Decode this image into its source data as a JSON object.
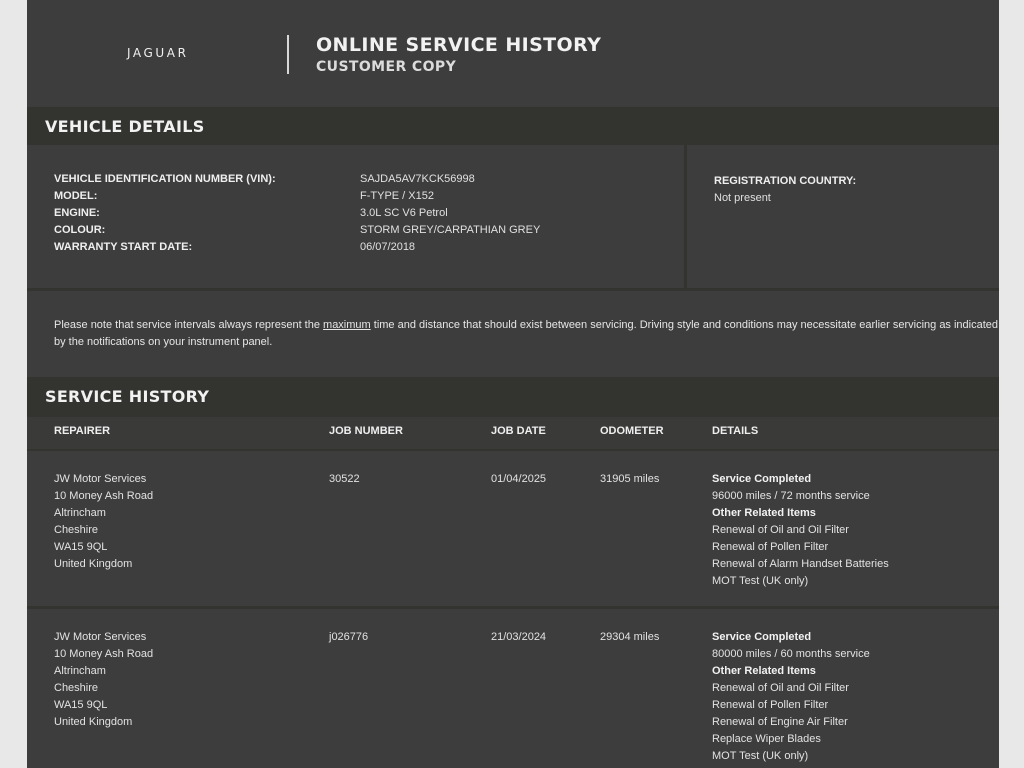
{
  "header": {
    "brand": "JAGUAR",
    "title": "ONLINE SERVICE HISTORY",
    "subtitle": "CUSTOMER COPY"
  },
  "vehicle": {
    "heading": "VEHICLE DETAILS",
    "fields": [
      {
        "label": "VEHICLE IDENTIFICATION NUMBER (VIN):",
        "value": "SAJDA5AV7KCK56998"
      },
      {
        "label": "MODEL:",
        "value": "F-TYPE / X152"
      },
      {
        "label": "ENGINE:",
        "value": "3.0L SC V6 Petrol"
      },
      {
        "label": "COLOUR:",
        "value": "STORM GREY/CARPATHIAN GREY"
      },
      {
        "label": "WARRANTY START DATE:",
        "value": "06/07/2018"
      }
    ],
    "registration_label": "REGISTRATION COUNTRY:",
    "registration_value": "Not present"
  },
  "notice": {
    "before": "Please note that service intervals always represent the ",
    "emphasis": "maximum",
    "after": " time and distance that should exist between servicing. Driving style and conditions may necessitate earlier servicing as indicated by the notifications on your instrument panel."
  },
  "service_history": {
    "heading": "SERVICE HISTORY",
    "columns": [
      "REPAIRER",
      "JOB NUMBER",
      "JOB DATE",
      "ODOMETER",
      "DETAILS"
    ],
    "jobs": [
      {
        "repairer": [
          "JW Motor Services",
          "10 Money Ash Road",
          "Altrincham",
          "Cheshire",
          "WA15 9QL",
          "United Kingdom"
        ],
        "job_number": "30522",
        "job_date": "01/04/2025",
        "odometer": "31905 miles",
        "service_label": "Service Completed",
        "service": "96000 miles / 72 months service",
        "other_label": "Other Related Items",
        "items": [
          "Renewal of Oil and Oil Filter",
          "Renewal of Pollen Filter",
          "Renewal of Alarm Handset Batteries",
          "MOT Test (UK only)"
        ]
      },
      {
        "repairer": [
          "JW Motor Services",
          "10 Money Ash Road",
          "Altrincham",
          "Cheshire",
          "WA15 9QL",
          "United Kingdom"
        ],
        "job_number": "j026776",
        "job_date": "21/03/2024",
        "odometer": "29304 miles",
        "service_label": "Service Completed",
        "service": "80000 miles / 60 months service",
        "other_label": "Other Related Items",
        "items": [
          "Renewal of Oil and Oil Filter",
          "Renewal of Pollen Filter",
          "Renewal of Engine Air Filter",
          "Replace Wiper Blades",
          "MOT Test (UK only)"
        ]
      }
    ]
  }
}
